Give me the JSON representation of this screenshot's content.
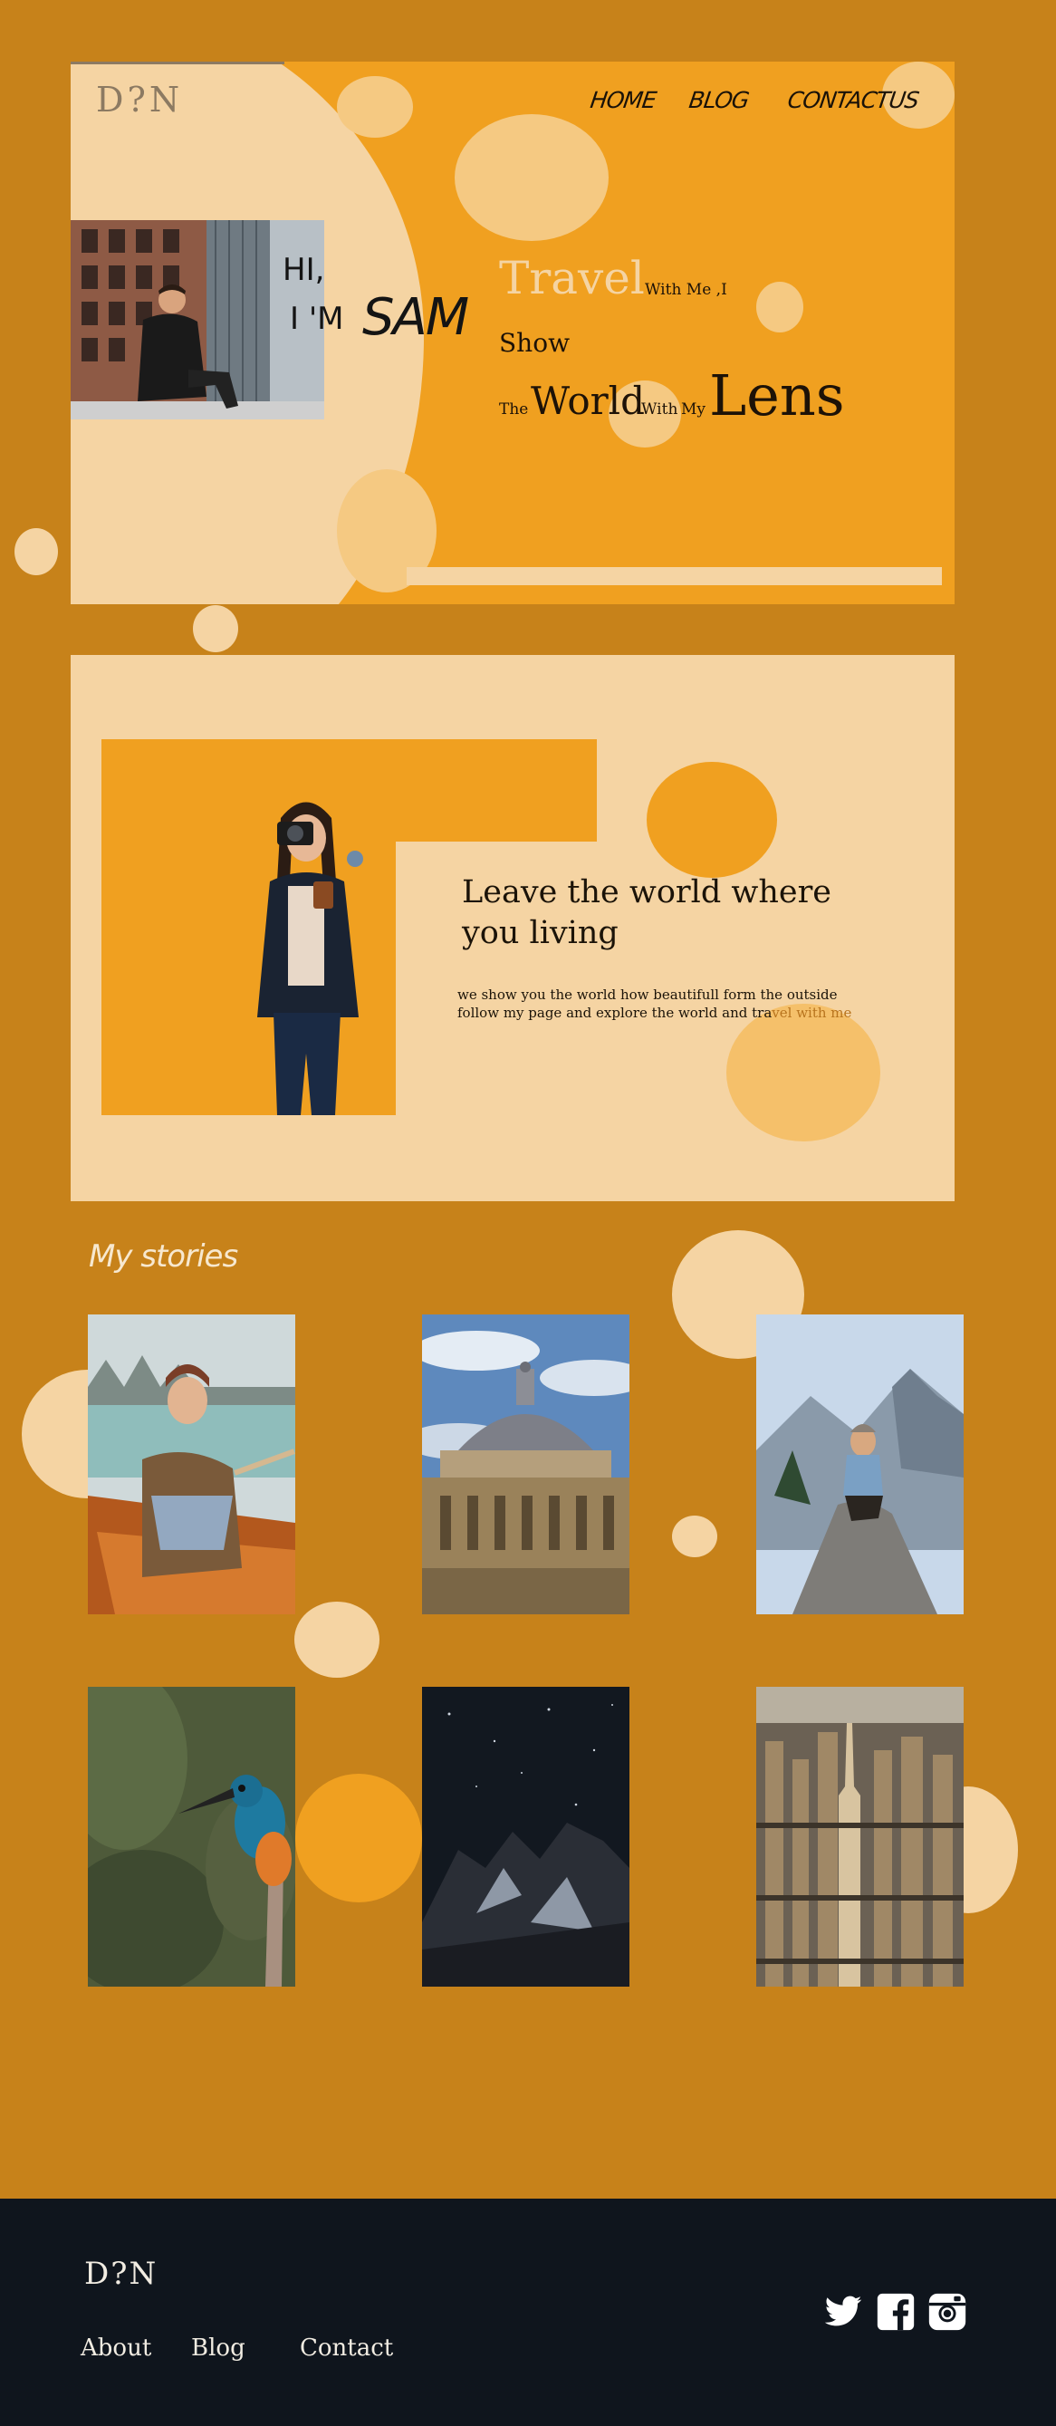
{
  "brand": {
    "logo": "D?N"
  },
  "nav": {
    "home": "HOME",
    "blog": "BLOG",
    "contact": "CONTACTUS"
  },
  "hero": {
    "hi": "HI,",
    "im": "I 'M",
    "name": "SAM",
    "travel": "Travel",
    "with_me": "With Me ,I",
    "show": "Show",
    "the": "The",
    "world": "World",
    "with": "With",
    "my": "My",
    "lens": "Lens"
  },
  "story": {
    "heading": "Leave  the world where you living",
    "subtitle_plain": "we show you the world how beautifull form the outside follow my page and explore the world and tra",
    "subtitle_accent": "vel with me"
  },
  "stories": {
    "title": "My stories",
    "items": [
      "lake boat",
      "domed building",
      "mountain rock",
      "kingfisher",
      "night mountains",
      "city skyline"
    ]
  },
  "footer": {
    "logo": "D?N",
    "links": [
      "About",
      "Blog",
      "Contact"
    ],
    "social": [
      "twitter-icon",
      "facebook-icon",
      "instagram-icon"
    ]
  },
  "colors": {
    "page_bg": "#c7821a",
    "hero_orange": "#f0a020",
    "cream": "#f5d4a3",
    "footer_bg": "#0f151d"
  }
}
